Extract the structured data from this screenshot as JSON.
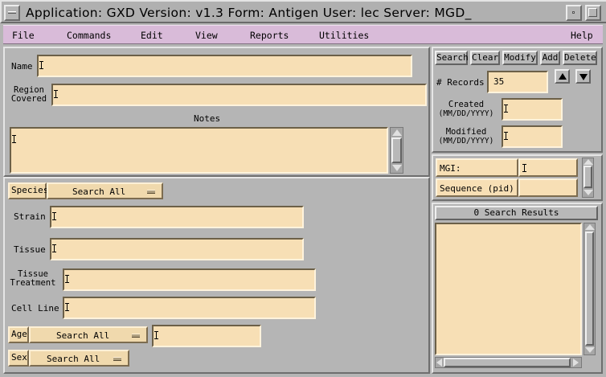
{
  "title_bar": {
    "text": "Application: GXD   Version: v1.3   Form: Antigen   User: lec   Server: MGD_"
  },
  "menu": {
    "file": "File",
    "commands": "Commands",
    "edit": "Edit",
    "view": "View",
    "reports": "Reports",
    "utilities": "Utilities",
    "help": "Help"
  },
  "form": {
    "name_label": "Name",
    "region_label_1": "Region",
    "region_label_2": "Covered",
    "notes_label": "Notes",
    "species_label": "Species",
    "species_value": "Search All",
    "strain_label": "Strain",
    "tissue_label": "Tissue",
    "tissue_treatment_label_1": "Tissue",
    "tissue_treatment_label_2": "Treatment",
    "cell_line_label": "Cell Line",
    "age_label": "Age",
    "age_value": "Search All",
    "sex_label": "Sex",
    "sex_value": "Search All"
  },
  "actions": {
    "search": "Search",
    "clear": "Clear",
    "modify": "Modify",
    "add": "Add",
    "delete": "Delete"
  },
  "records": {
    "label": "# Records",
    "value": "35",
    "created_label_1": "Created",
    "created_label_2": "(MM/DD/YYYY)",
    "modified_label_1": "Modified",
    "modified_label_2": "(MM/DD/YYYY)"
  },
  "accession": {
    "mgi_label": "MGI:",
    "sequence_label": "Sequence (pid)"
  },
  "results": {
    "header": "0 Search Results"
  },
  "colors": {
    "field_bg": "#f7dfb5",
    "menubar_bg": "#d9bbd9",
    "window_bg": "#b5b5b5"
  }
}
